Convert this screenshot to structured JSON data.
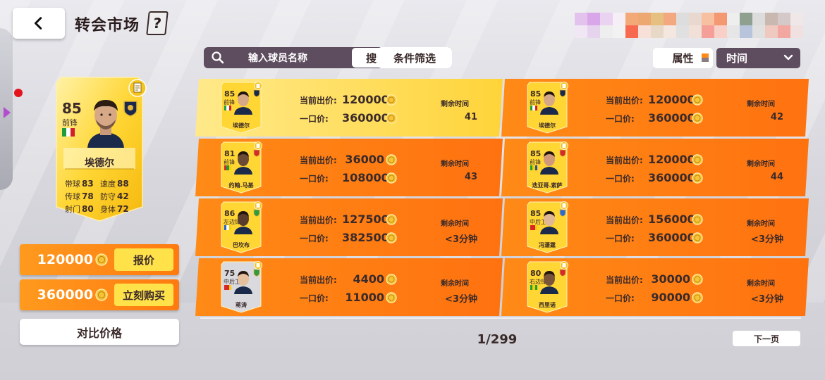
{
  "header": {
    "title": "转会市场",
    "help_glyph": "?"
  },
  "search": {
    "placeholder": "输入球员名称",
    "search_label": "搜索",
    "filter_label": "条件筛选"
  },
  "sort": {
    "attribute_label": "属性",
    "selected": "时间"
  },
  "selected_player": {
    "rating": "85",
    "position": "前锋",
    "name": "埃德尔",
    "stats": [
      {
        "label": "带球",
        "value": "83",
        "label2": "速度",
        "value2": "88"
      },
      {
        "label": "传球",
        "value": "78",
        "label2": "防守",
        "value2": "42"
      },
      {
        "label": "射门",
        "value": "80",
        "label2": "身体",
        "value2": "72"
      }
    ]
  },
  "offer": {
    "bid_amount": "120000",
    "bid_label": "报价",
    "buyout_amount": "360000",
    "buyout_label": "立刻购买",
    "compare_label": "对比价格"
  },
  "labels": {
    "current_bid": "当前出价:",
    "buyout": "一口价:",
    "time_left": "剩余时间"
  },
  "listings": [
    {
      "rating": "85",
      "position": "前锋",
      "name": "埃德尔",
      "bid": "120000",
      "buyout": "360000",
      "time": "41"
    },
    {
      "rating": "85",
      "position": "前锋",
      "name": "埃德尔",
      "bid": "120000",
      "buyout": "360000",
      "time": "42"
    },
    {
      "rating": "81",
      "position": "前锋",
      "name": "约翰.马基",
      "bid": "36000",
      "buyout": "108000",
      "time": "43"
    },
    {
      "rating": "85",
      "position": "前锋",
      "name": "迭亚哥.索萨",
      "bid": "120000",
      "buyout": "360000",
      "time": "44"
    },
    {
      "rating": "86",
      "position": "左边锋",
      "name": "巴坎布",
      "bid": "127500",
      "buyout": "382500",
      "time": "<3分钟"
    },
    {
      "rating": "85",
      "position": "中后卫",
      "name": "冯潇霆",
      "bid": "156000",
      "buyout": "360000",
      "time": "<3分钟"
    },
    {
      "rating": "75",
      "position": "中后卫",
      "name": "蒋涛",
      "bid": "4400",
      "buyout": "11000",
      "time": "<3分钟"
    },
    {
      "rating": "80",
      "position": "右边锋",
      "name": "西里诺",
      "bid": "30000",
      "buyout": "90000",
      "time": "<3分钟"
    }
  ],
  "pagination": {
    "page": "1/299",
    "next_label": "下一页"
  },
  "colors": {
    "accent_orange": "#ff7f13",
    "card_gold": "#ffd634",
    "panel_dark": "#5e4c5f",
    "button_yellow": "#ffe14a"
  }
}
